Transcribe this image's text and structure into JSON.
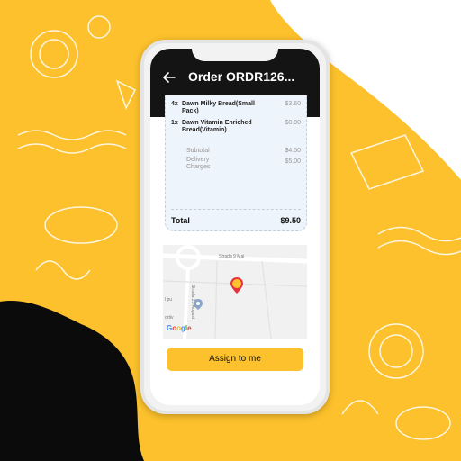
{
  "colors": {
    "brand_yellow": "#fcc12c",
    "header_black": "#141414",
    "receipt_bg": "#eef4fb"
  },
  "header": {
    "title": "Order ORDR126...",
    "back_icon": "arrow-left-icon"
  },
  "receipt": {
    "items": [
      {
        "qty": "4x",
        "name": "Dawn Milky Bread(Small Pack)",
        "price": "$3.60"
      },
      {
        "qty": "1x",
        "name": "Dawn Vitamin Enriched Bread(Vitamin)",
        "price": "$0.90"
      }
    ],
    "subtotal_label": "Subtotal",
    "subtotal_value": "$4.50",
    "delivery_label": "Delivery Charges",
    "delivery_value": "$5.00",
    "total_label": "Total",
    "total_value": "$9.50"
  },
  "map": {
    "road_label_1": "Strada 9 Mai",
    "road_label_2": "Strada 23 August",
    "place_label": "l pu",
    "place_label_2": "ortiv",
    "logo": "Google"
  },
  "action": {
    "assign_label": "Assign to me"
  }
}
